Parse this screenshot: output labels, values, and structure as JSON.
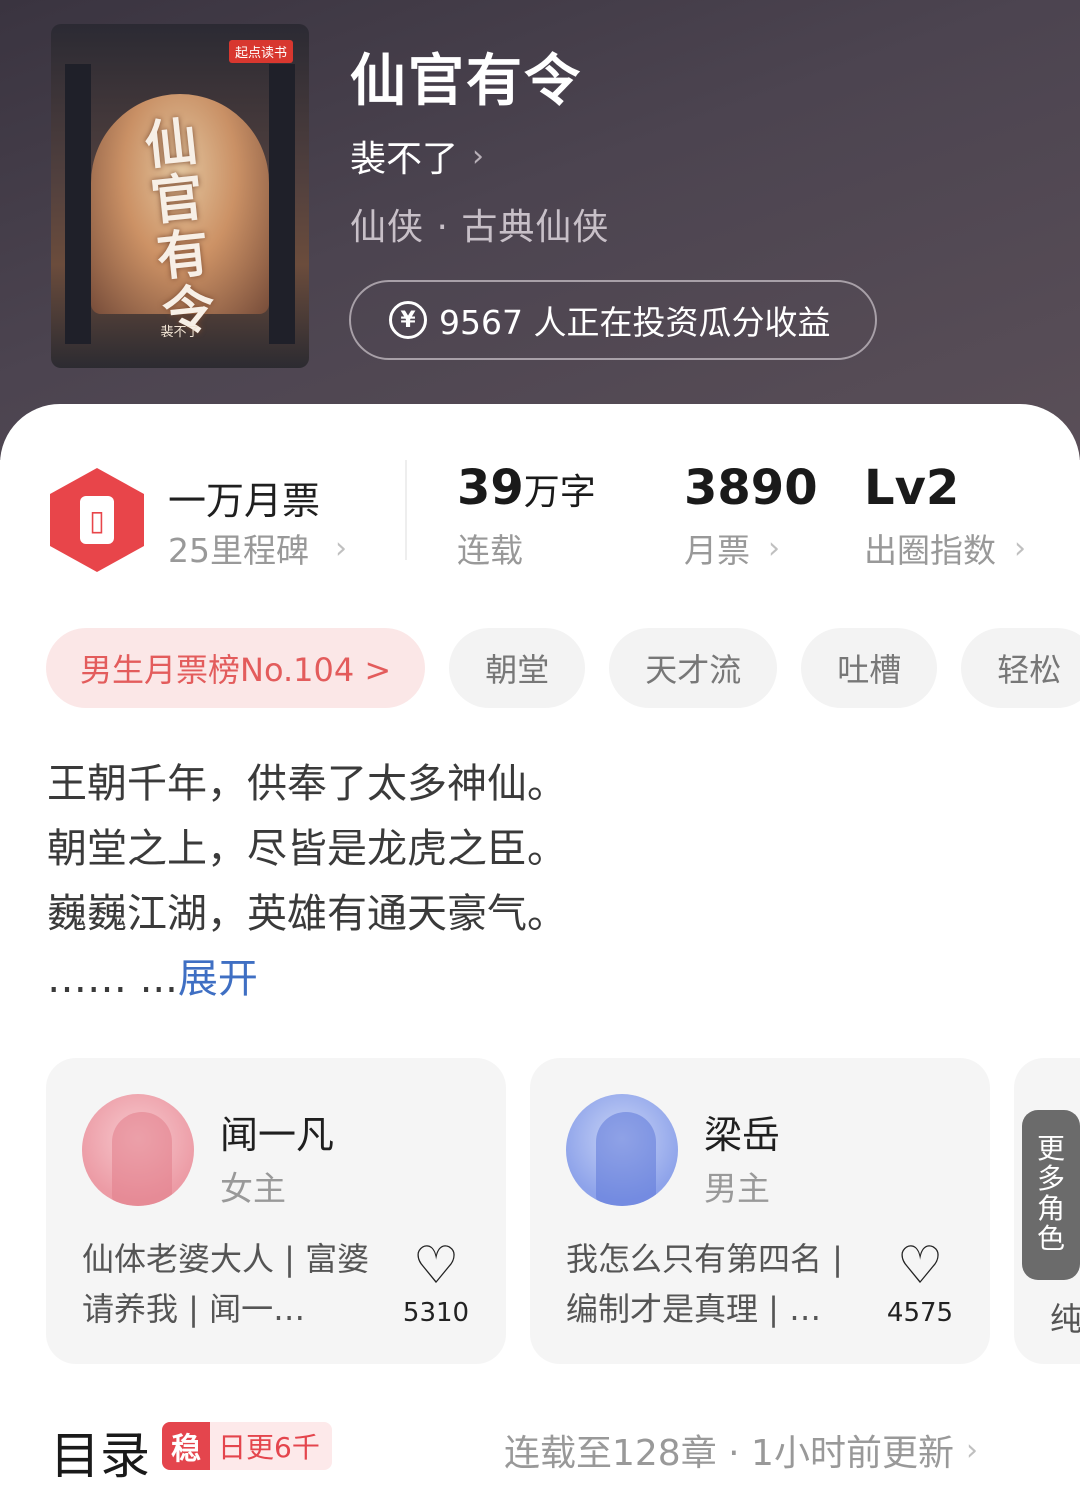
{
  "book": {
    "title": "仙官有令",
    "author": "裴不了",
    "genre": "仙侠 · 古典仙侠",
    "invest_text": "9567 人正在投资瓜分收益",
    "cover_title": "仙官有令",
    "cover_publisher": "起点读书",
    "cover_author": "裴不了"
  },
  "stats": {
    "milestone_title": "一万月票",
    "milestone_sub": "25里程碑",
    "words_num": "39",
    "words_unit": "万字",
    "words_label": "连载",
    "tickets_num": "3890",
    "tickets_label": "月票",
    "index_num": "Lv2",
    "index_label": "出圈指数"
  },
  "tags": [
    "男生月票榜No.104 >",
    "朝堂",
    "天才流",
    "吐槽",
    "轻松"
  ],
  "synopsis": {
    "lines": [
      "王朝千年，供奉了太多神仙。",
      "朝堂之上，尽皆是龙虎之臣。",
      "巍巍江湖，英雄有通天豪气。"
    ],
    "ellipsis": "…… ...",
    "expand": "展开"
  },
  "characters": [
    {
      "name": "闻一凡",
      "role": "女主",
      "desc": "仙体老婆大人 | 富婆请养我 | 闻一…",
      "likes": "5310"
    },
    {
      "name": "梁岳",
      "role": "男主",
      "desc": "我怎么只有第四名 | 编制才是真理 | …",
      "likes": "4575"
    }
  ],
  "more_roles": {
    "label": "更多角色",
    "peek": "纯"
  },
  "toc": {
    "title": "目录",
    "badge_icon": "稳",
    "badge_text": "日更6千",
    "status": "连载至128章 · 1小时前更新"
  },
  "colors": {
    "header_bg": "#3a3440",
    "accent_red": "#e8454a",
    "link_blue": "#3f6fc3",
    "rank_tag_bg": "#fbe7e7"
  }
}
